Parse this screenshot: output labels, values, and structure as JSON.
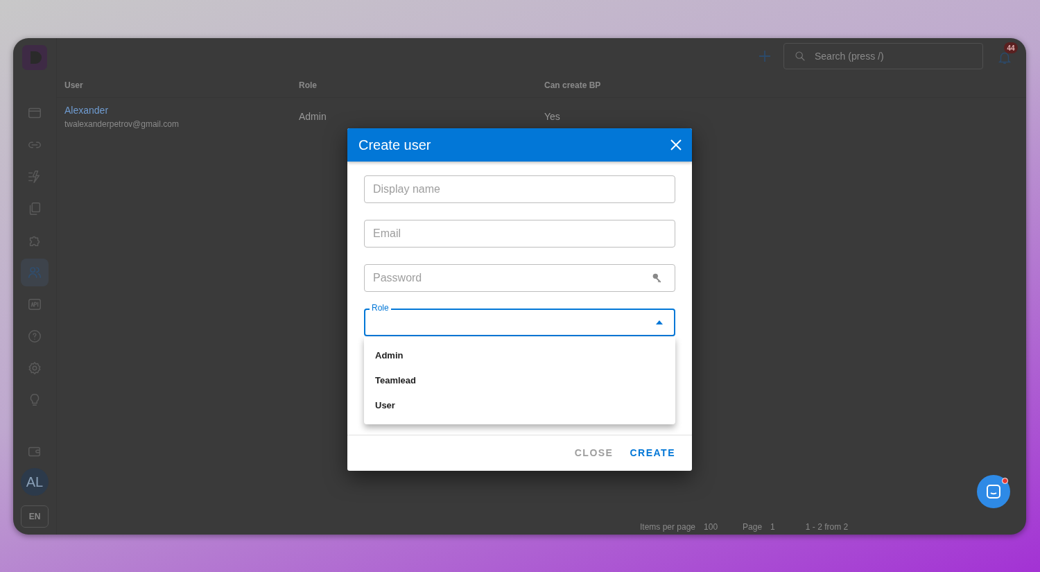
{
  "app": {
    "search": {
      "placeholder": "Search (press /)"
    },
    "notifications": {
      "count": "44"
    },
    "sidebar": {
      "items": [
        {
          "selected": false
        },
        {
          "selected": false
        },
        {
          "selected": false
        },
        {
          "selected": false
        },
        {
          "selected": false
        },
        {
          "selected": true
        },
        {
          "selected": false
        },
        {
          "selected": false
        },
        {
          "selected": false
        },
        {
          "selected": false
        },
        {
          "selected": false
        }
      ],
      "avatar": "AL",
      "language": "EN"
    },
    "table": {
      "columns": [
        "User",
        "Role",
        "Can create BP"
      ],
      "rows": [
        {
          "name": "Alexander",
          "email": "twalexanderpetrov@gmail.com",
          "role": "Admin",
          "can_create_bp": "Yes"
        }
      ]
    },
    "pagination": {
      "items_per_page_label": "Items per page",
      "items_per_page": "100",
      "page_label": "Page",
      "page": "1",
      "range": "1 - 2 from 2"
    },
    "chat": {
      "unread": true
    }
  },
  "dialog": {
    "title": "Create user",
    "fields": [
      {
        "kind": "text",
        "placeholder": "Display name"
      },
      {
        "kind": "text",
        "placeholder": "Email"
      },
      {
        "kind": "password",
        "placeholder": "Password"
      },
      {
        "kind": "select",
        "label": "Role",
        "focused": true,
        "expanded": true,
        "options": [
          {
            "label": "Admin",
            "selected": false
          },
          {
            "label": "Teamlead",
            "selected": false
          },
          {
            "label": "User",
            "selected": false
          }
        ]
      }
    ],
    "buttons": [
      {
        "label": "CLOSE",
        "kind": "secondary"
      },
      {
        "label": "CREATE",
        "kind": "primary"
      }
    ]
  }
}
